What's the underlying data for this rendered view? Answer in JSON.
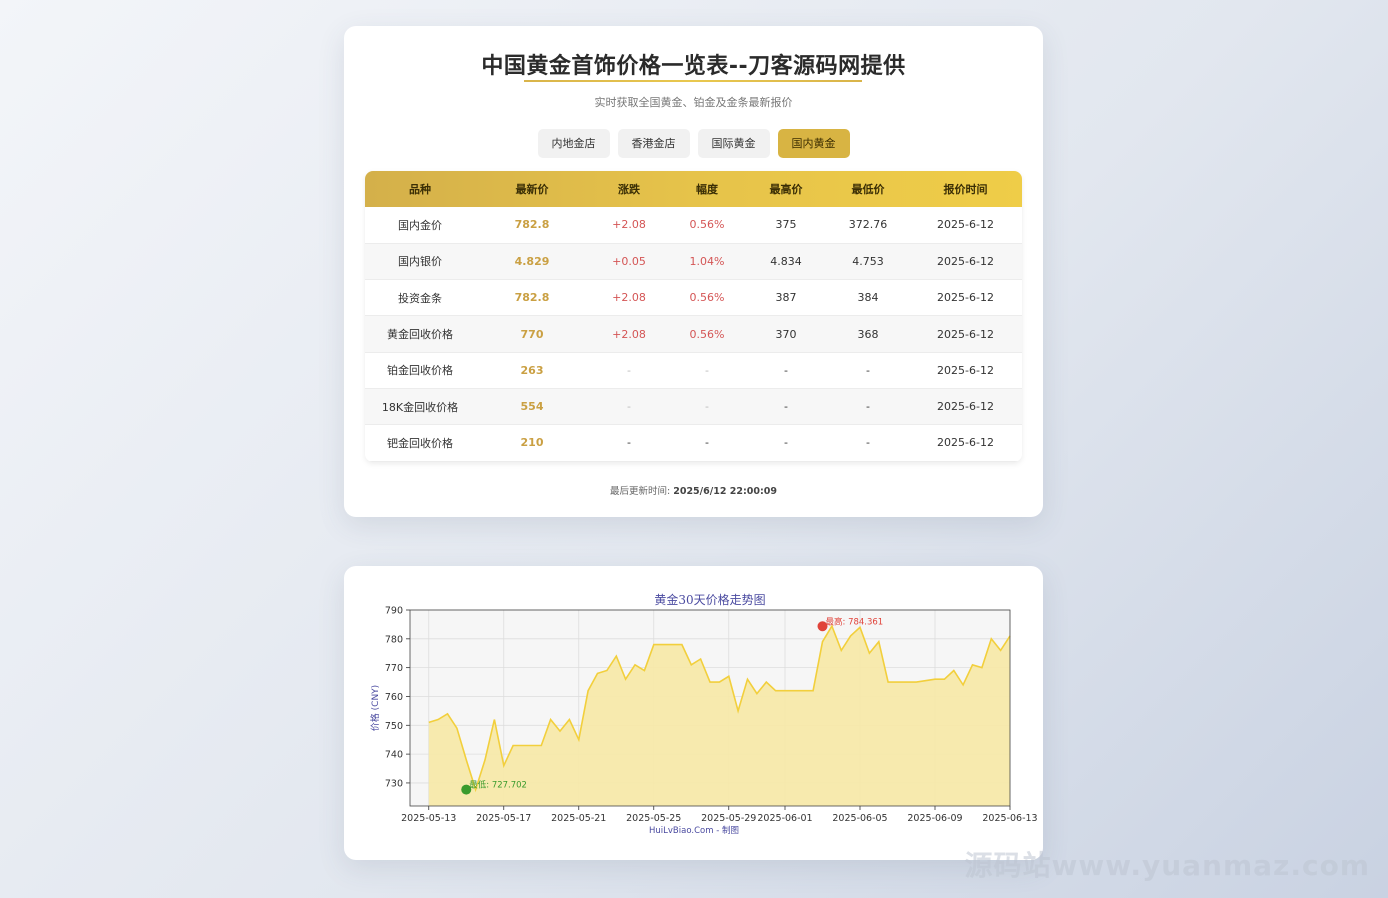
{
  "header": {
    "title": "中国黄金首饰价格一览表--刀客源码网提供",
    "subtitle": "实时获取全国黄金、铂金及金条最新报价"
  },
  "tabs": [
    {
      "label": "内地金店",
      "active": false
    },
    {
      "label": "香港金店",
      "active": false
    },
    {
      "label": "国际黄金",
      "active": false
    },
    {
      "label": "国内黄金",
      "active": true
    }
  ],
  "table": {
    "columns": [
      "品种",
      "最新价",
      "涨跌",
      "幅度",
      "最高价",
      "最低价",
      "报价时间"
    ],
    "rows": [
      [
        "国内金价",
        "782.8",
        "+2.08",
        "0.56%",
        "375",
        "372.76",
        "2025-6-12"
      ],
      [
        "国内银价",
        "4.829",
        "+0.05",
        "1.04%",
        "4.834",
        "4.753",
        "2025-6-12"
      ],
      [
        "投资金条",
        "782.8",
        "+2.08",
        "0.56%",
        "387",
        "384",
        "2025-6-12"
      ],
      [
        "黄金回收价格",
        "770",
        "+2.08",
        "0.56%",
        "370",
        "368",
        "2025-6-12"
      ],
      [
        "铂金回收价格",
        "263",
        "-",
        "-",
        "-",
        "-",
        "2025-6-12"
      ],
      [
        "18K金回收价格",
        "554",
        "-",
        "-",
        "-",
        "-",
        "2025-6-12"
      ],
      [
        "钯金回收价格",
        "210",
        "-",
        "-",
        "-",
        "-",
        "2025-6-12"
      ]
    ]
  },
  "updated": {
    "label": "最后更新时间:",
    "value": "2025/6/12 22:00:09"
  },
  "watermark": "源码站www.yuanmaz.com",
  "colors": {
    "accent": "#d8b443",
    "price": "#caa043",
    "up": "#d45555",
    "line": "#f2cf3c",
    "fill": "#f7e9a6",
    "max_marker": "#e0433a",
    "min_marker": "#3a9b2d",
    "chart_title": "#4a4aa0"
  },
  "chart_data": {
    "type": "area",
    "title": "黄金30天价格走势图",
    "xlabel": "",
    "ylabel": "价格 (CNY)",
    "footer": "HuiLvBiao.Com - 制图",
    "ylim": [
      722,
      790
    ],
    "yticks": [
      730,
      740,
      750,
      760,
      770,
      780,
      790
    ],
    "xlim": [
      "2025-05-12",
      "2025-06-13"
    ],
    "xticks": [
      "2025-05-13",
      "2025-05-17",
      "2025-05-21",
      "2025-05-25",
      "2025-05-29",
      "2025-06-01",
      "2025-06-05",
      "2025-06-09",
      "2025-06-13"
    ],
    "grid": true,
    "annotations": [
      {
        "label": "最高: 784.361",
        "x": "2025-06-03",
        "y": 784.361
      },
      {
        "label": "最低: 727.702",
        "x": "2025-05-15",
        "y": 727.702
      }
    ],
    "points": [
      [
        "2025-05-13",
        751
      ],
      [
        "2025-05-13",
        752
      ],
      [
        "2025-05-14",
        754
      ],
      [
        "2025-05-14",
        749
      ],
      [
        "2025-05-15",
        738
      ],
      [
        "2025-05-15",
        727.7
      ],
      [
        "2025-05-16",
        738
      ],
      [
        "2025-05-16",
        752
      ],
      [
        "2025-05-17",
        736
      ],
      [
        "2025-05-17",
        743
      ],
      [
        "2025-05-18",
        743
      ],
      [
        "2025-05-19",
        743
      ],
      [
        "2025-05-19",
        752
      ],
      [
        "2025-05-20",
        748
      ],
      [
        "2025-05-20",
        752
      ],
      [
        "2025-05-21",
        745
      ],
      [
        "2025-05-21",
        762
      ],
      [
        "2025-05-22",
        768
      ],
      [
        "2025-05-22",
        769
      ],
      [
        "2025-05-23",
        774
      ],
      [
        "2025-05-23",
        766
      ],
      [
        "2025-05-24",
        771
      ],
      [
        "2025-05-24",
        769
      ],
      [
        "2025-05-25",
        778
      ],
      [
        "2025-05-26",
        778
      ],
      [
        "2025-05-26",
        778
      ],
      [
        "2025-05-27",
        771
      ],
      [
        "2025-05-27",
        773
      ],
      [
        "2025-05-28",
        765
      ],
      [
        "2025-05-28",
        765
      ],
      [
        "2025-05-29",
        767
      ],
      [
        "2025-05-29",
        755
      ],
      [
        "2025-05-30",
        766
      ],
      [
        "2025-05-30",
        761
      ],
      [
        "2025-05-31",
        765
      ],
      [
        "2025-05-31",
        762
      ],
      [
        "2025-06-01",
        762
      ],
      [
        "2025-06-02",
        762
      ],
      [
        "2025-06-02",
        762
      ],
      [
        "2025-06-03",
        779
      ],
      [
        "2025-06-03",
        784.4
      ],
      [
        "2025-06-04",
        776
      ],
      [
        "2025-06-04",
        781
      ],
      [
        "2025-06-05",
        784
      ],
      [
        "2025-06-05",
        775
      ],
      [
        "2025-06-06",
        779
      ],
      [
        "2025-06-06",
        765
      ],
      [
        "2025-06-07",
        765
      ],
      [
        "2025-06-08",
        765
      ],
      [
        "2025-06-09",
        766
      ],
      [
        "2025-06-09",
        766
      ],
      [
        "2025-06-10",
        769
      ],
      [
        "2025-06-10",
        764
      ],
      [
        "2025-06-11",
        771
      ],
      [
        "2025-06-11",
        770
      ],
      [
        "2025-06-12",
        780
      ],
      [
        "2025-06-12",
        776
      ],
      [
        "2025-06-13",
        781
      ]
    ]
  }
}
